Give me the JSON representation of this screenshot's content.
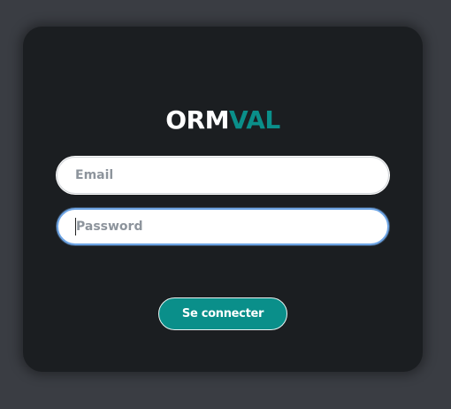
{
  "brand": {
    "part1": "ORM",
    "part2": "VAL",
    "primary_color": "#ffffff",
    "accent_color": "#0a8f8a"
  },
  "form": {
    "email": {
      "placeholder": "Email",
      "value": ""
    },
    "password": {
      "placeholder": "Password",
      "value": "",
      "focused": true
    },
    "submit_label": "Se connecter"
  },
  "colors": {
    "background": "#3a3d43",
    "card": "#1b1e21",
    "focus_ring": "#6fa6e6",
    "button": "#0a8f8a"
  }
}
